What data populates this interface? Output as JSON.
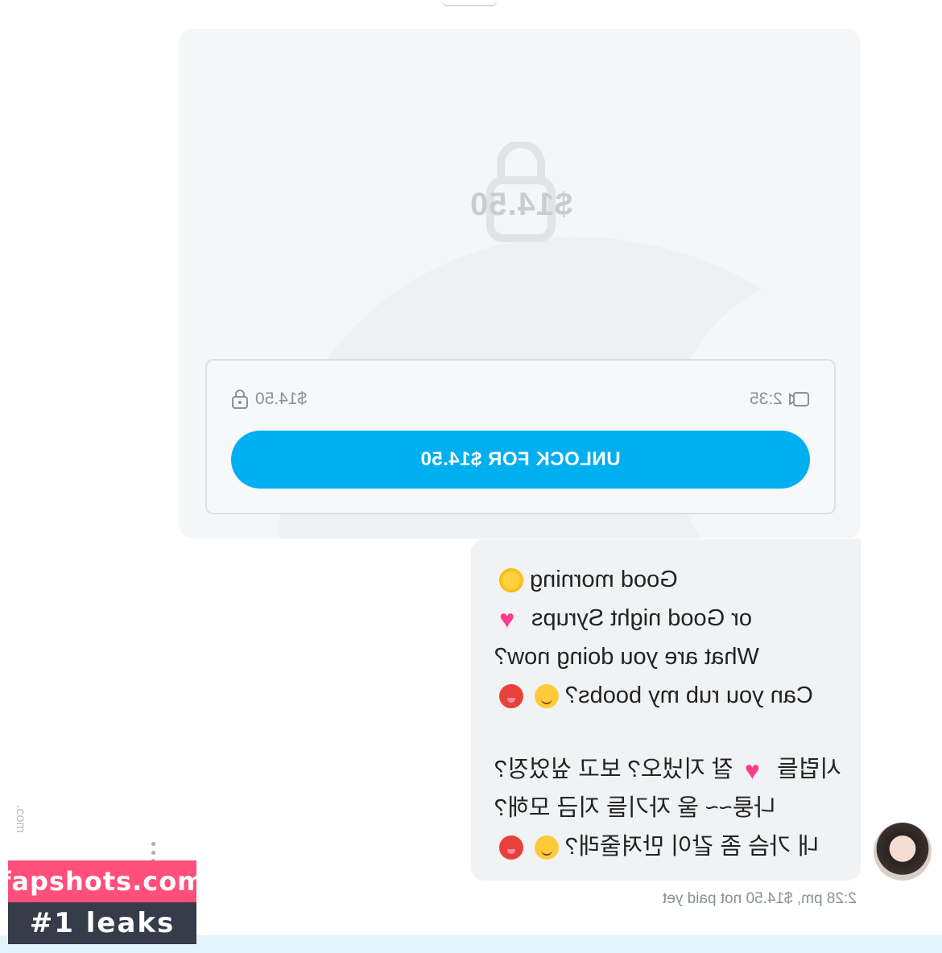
{
  "colors": {
    "accent": "#00aff0",
    "card_bg": "#f4f6f7",
    "bubble_bg": "#f0f2f4",
    "watermark_pink": "#ff4f7a",
    "watermark_dark": "#363c4a"
  },
  "media": {
    "price_overlay": "$14.50",
    "lock_icon": "padlock-icon",
    "video_icon": "video-camera-icon",
    "duration": "2:35",
    "price_label": "$14.50",
    "unlock_label": "UNLOCK FOR $14.50"
  },
  "message": {
    "lines": [
      {
        "text": "Good morning",
        "emoji": [
          "sun"
        ]
      },
      {
        "text": "or Good night Syrups",
        "emoji": [
          "heart"
        ]
      },
      {
        "text": "What are you doing now?",
        "emoji": []
      },
      {
        "text": "Can you rub my boobs?",
        "emoji": [
          "blush",
          "hot"
        ]
      },
      {
        "text": "시럽들",
        "emoji": [
          "heart"
        ],
        "tail": " 잘 지냈오? 보고 싶었징?"
      },
      {
        "text": "나룽~~ 울 자기들 지금 모해?",
        "emoji": []
      },
      {
        "text": "내 가슴 좀 같이 만져줄래?",
        "emoji": [
          "blush",
          "hot"
        ]
      }
    ],
    "timestamp": "2:28 pm, $14.50 not paid yet"
  },
  "watermark": {
    "site": "fapshots.com",
    "tagline": "#1 leaks",
    "side_text": ".com"
  }
}
